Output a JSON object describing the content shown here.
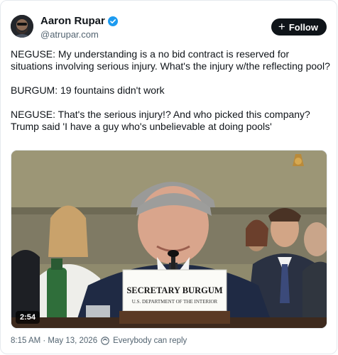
{
  "author": {
    "display_name": "Aaron Rupar",
    "handle": "@atrupar.com",
    "verified_icon": "verified-badge-icon"
  },
  "follow": {
    "label": "Follow",
    "icon": "plus-icon"
  },
  "tweet": {
    "paragraphs": [
      "NEGUSE: My understanding is a no bid contract is reserved for situations involving serious injury. What's the injury w/the reflecting pool?",
      "BURGUM: 19 fountains didn't work",
      "NEGUSE: That's the serious injury!? And who picked this company? Trump said 'I have a guy who's unbelievable at doing pools'"
    ]
  },
  "media": {
    "duration": "2:54",
    "nameplate_title": "SECRETARY BURGUM",
    "nameplate_subtitle": "U.S. DEPARTMENT OF THE INTERIOR"
  },
  "footer": {
    "timestamp": "8:15 AM · May 13, 2026",
    "reply_setting": "Everybody can reply"
  },
  "colors": {
    "follow_bg": "#0f1419",
    "verified": "#1d9bf0",
    "secondary_text": "#536471"
  }
}
